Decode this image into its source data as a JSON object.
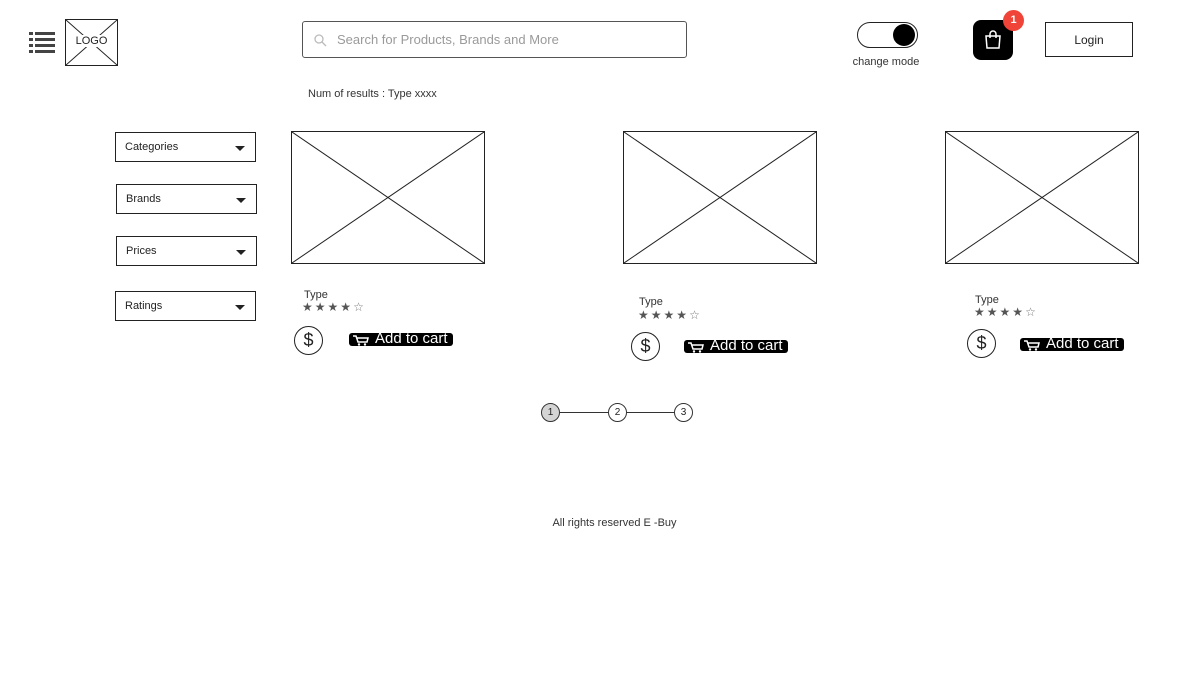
{
  "header": {
    "logo_text": "LOGO",
    "search_placeholder": "Search for Products, Brands and More",
    "toggle_label": "change mode",
    "cart_count": "1",
    "login_label": "Login"
  },
  "results_text": "Num of results : Type xxxx",
  "filters": [
    {
      "label": "Categories"
    },
    {
      "label": "Brands"
    },
    {
      "label": "Prices"
    },
    {
      "label": "Ratings"
    }
  ],
  "products": [
    {
      "type": "Type",
      "rating": 4,
      "rating_max": 5,
      "price_symbol": "$",
      "button_label": "Add to cart"
    },
    {
      "type": "Type",
      "rating": 4,
      "rating_max": 5,
      "price_symbol": "$",
      "button_label": "Add to cart"
    },
    {
      "type": "Type",
      "rating": 4,
      "rating_max": 5,
      "price_symbol": "$",
      "button_label": "Add to cart"
    }
  ],
  "pagination": {
    "pages": [
      "1",
      "2",
      "3"
    ],
    "current": "1"
  },
  "footer_text": "All rights reserved E -Buy",
  "colors": {
    "badge": "#f04438",
    "accent": "#000000",
    "active_page": "#d4d4d4"
  },
  "icons": {
    "menu": "list-icon",
    "search": "search-icon",
    "cart": "shopping-bag-icon",
    "price": "dollar-icon",
    "add_to_cart": "cart-icon"
  }
}
